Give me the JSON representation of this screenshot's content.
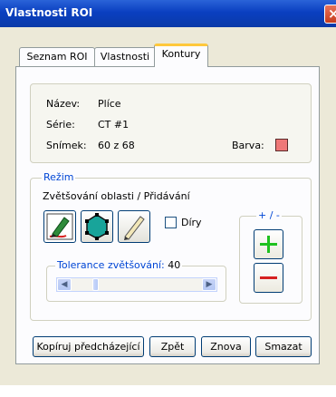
{
  "window": {
    "title": "Vlastnosti ROI",
    "close_glyph": "×"
  },
  "tabs": [
    {
      "label": "Seznam ROI",
      "active": false
    },
    {
      "label": "Vlastnosti",
      "active": false
    },
    {
      "label": "Kontury",
      "active": true
    }
  ],
  "info": {
    "name_label": "Název:",
    "name_value": "Plíce",
    "series_label": "Série:",
    "series_value": "CT #1",
    "image_label": "Snímek:",
    "image_value": "60 z 68",
    "color_label": "Barva:",
    "color_value": "#ef7878"
  },
  "mode": {
    "legend": "Režim",
    "description": "Zvětšování oblasti / Přidávání",
    "tools": [
      "marker-tool-icon",
      "polygon-tool-icon",
      "pencil-tool-icon"
    ],
    "holes_label": "Díry",
    "holes_checked": false,
    "tolerance_legend": "Tolerance zvětšování:",
    "tolerance_value": "40",
    "tolerance_fraction": 0.17,
    "plusminus_legend": "+ / -",
    "plus_glyph": "+",
    "minus_glyph": "−"
  },
  "buttons": {
    "copy_previous": "Kopíruj předcházející",
    "undo": "Zpět",
    "redo": "Znova",
    "delete": "Smazat"
  },
  "colors": {
    "accent": "#0046d5",
    "plus": "#1fc11f",
    "minus": "#d62020"
  }
}
